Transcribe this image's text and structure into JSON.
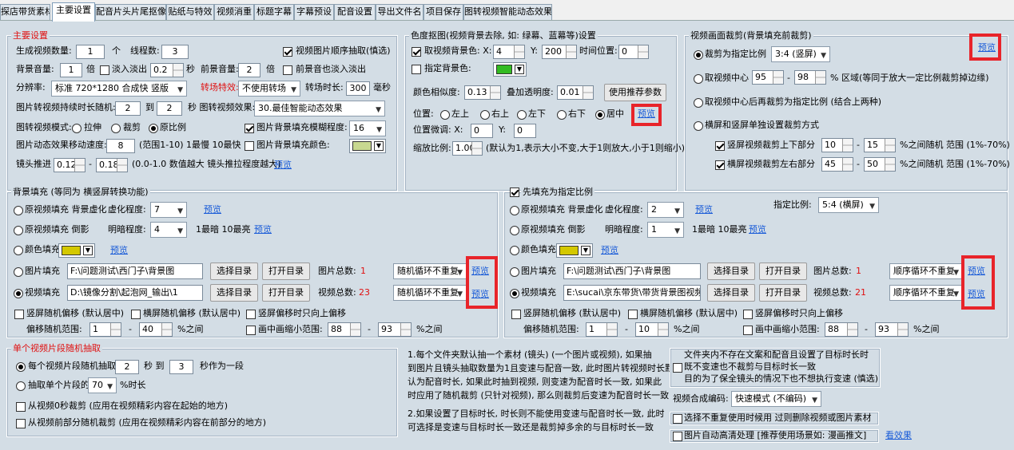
{
  "tabs": [
    "探店带货素材",
    "主要设置",
    "配音片头片尾抠像",
    "贴纸与特效",
    "视频消重",
    "标题字幕",
    "字幕预设",
    "配音设置",
    "导出文件名",
    "项目保存",
    "图转视频智能动态效果"
  ],
  "common": {
    "preview": "预览",
    "choose_dir": "选择目录",
    "open_dir": "打开目录",
    "to": "到",
    "dash": "-",
    "view_effect": "看效果"
  },
  "main": {
    "title": "主要设置",
    "gen_count_label": "生成视频数量:",
    "gen_count": "1",
    "gen_unit": "个",
    "threads_label": "线程数:",
    "threads": "3",
    "seq_extract": "视频图片顺序抽取(慎选)",
    "bg_vol_label": "背景音量:",
    "bg_vol": "1",
    "times": "倍",
    "fade_label": "淡入淡出",
    "fade_val": "0.2",
    "sec": "秒",
    "fg_vol_label": "前景音量:",
    "fg_vol": "2",
    "fg_fade": "前景音也淡入淡出",
    "res_label": "分辨率:",
    "res_val": "标准 720*1280 合成快 竖版",
    "trans_label": "转场特效:",
    "trans_val": "不使用转场",
    "trans_dur_label": "转场时长:",
    "trans_dur": "300",
    "ms": "毫秒",
    "img_dur_label": "图片转视频持续时长随机:",
    "img_dur_a": "2",
    "img_dur_b": "2",
    "img_effect_label": "秒 图转视频效果:",
    "img_effect_val": "30.最佳智能动态效果",
    "img_mode_label": "图转视频模式:",
    "mode_stretch": "拉伸",
    "mode_crop": "裁剪",
    "mode_ratio": "原比例",
    "blur_label": "图片背景填充模糊程度:",
    "blur_val": "16",
    "speed_label": "图片动态效果移动速度:",
    "speed_val": "8",
    "speed_hint": "(范围1-10) 1最慢 10最快",
    "bg_color_label": "图片背景填充颜色:",
    "push_label": "镜头推进",
    "push_a": "0.12",
    "push_b": "0.18",
    "push_hint": "(0.0-1.0 数值越大 镜头推拉程度越大)"
  },
  "chroma": {
    "title": "色度抠图(视频背景去除, 如: 绿幕、蓝幕等)设置",
    "take_color": "取视频背景色: X:",
    "x_val": "4",
    "y_label": "Y:",
    "y_val": "200",
    "time_pos_label": "时间位置:",
    "time_pos": "0",
    "spec_bg": "指定背景色:",
    "similarity_label": "颜色相似度:",
    "similarity": "0.13",
    "overlay_label": "叠加透明度:",
    "overlay": "0.01",
    "recommend": "使用推荐参数",
    "pos_label": "位置:",
    "pos_tl": "左上",
    "pos_tr": "右上",
    "pos_bl": "左下",
    "pos_br": "右下",
    "pos_c": "居中",
    "fine_label": "位置微调:  X:",
    "fine_x": "0",
    "fine_y_label": "Y:",
    "fine_y": "0",
    "scale_label": "缩放比例:",
    "scale": "1.00",
    "scale_hint": "(默认为1,表示大小不变,大于1则放大,小于1则缩小)"
  },
  "crop": {
    "title": "视频画面裁剪(背景填充前裁剪)",
    "opt1": "裁剪为指定比例",
    "opt1_val": "3:4 (竖屏)",
    "opt2": "取视频中心",
    "opt2_a": "95",
    "opt2_b": "98",
    "opt2_hint": "% 区域(等同于放大一定比例裁剪掉边缘)",
    "opt3": "取视频中心后再裁剪为指定比例 (结合上两种)",
    "opt4": "横屏和竖屏单独设置裁剪方式",
    "v_label": "竖屏视频裁剪上下部分",
    "v_a": "10",
    "v_b": "15",
    "v_hint": "%之间随机 范围 (1%-70%)",
    "h_label": "横屏视频裁剪左右部分",
    "h_a": "45",
    "h_b": "50",
    "h_hint": "%之间随机 范围 (1%-70%)"
  },
  "bgfill": {
    "title": "背景填充 (等同为 横竖屏转换功能)",
    "orig_blur": "原视频填充 背景虚化",
    "blur_deg_label": "虚化程度:",
    "blur_deg": "7",
    "orig_inv": "原视频填充 倒影",
    "bright_label": "明暗程度:",
    "bright": "4",
    "bright_hint": "1最暗 10最亮",
    "color_fill": "颜色填充",
    "img_fill": "图片填充",
    "img_path": "F:\\问题测试\\西门子\\背景图",
    "img_total_label": "图片总数:",
    "img_total": "1",
    "img_mode": "随机循环不重复",
    "vid_fill": "视频填充",
    "vid_path": "D:\\镜像分割\\起泡网_输出\\1",
    "vid_total_label": "视频总数:",
    "vid_total": "23",
    "vid_mode": "随机循环不重复",
    "v_offset": "竖屏随机偏移 (默认居中)",
    "h_offset": "横屏随机偏移 (默认居中)",
    "v_up": "竖屏偏移时只向上偏移",
    "offset_range_label": "偏移随机范围:",
    "off_a": "1",
    "off_b": "40",
    "pct_between": "%之间",
    "shrink_label": "画中画缩小范围:",
    "shrink_a": "88",
    "shrink_b": "93"
  },
  "fill2": {
    "title": "先填充为指定比例",
    "ratio_label": "指定比例:",
    "ratio_val": "5:4 (横屏)",
    "blur_deg": "2",
    "bright": "1",
    "img_path": "F:\\问题测试\\西门子\\背景图",
    "img_total": "1",
    "img_mode": "顺序循环不重复",
    "vid_path": "E:\\sucai\\京东带货\\带货背景图视频",
    "vid_total": "21",
    "vid_mode": "顺序循环不重复",
    "off_a": "1",
    "off_b": "10",
    "shrink_a": "88",
    "shrink_b": "93"
  },
  "clip": {
    "title": "单个视频片段随机抽取",
    "opt1": "每个视频片段随机抽取",
    "opt1_a": "2",
    "sec_to": "秒 到",
    "opt1_b": "3",
    "opt1_hint": "秒作为一段",
    "opt2": "抽取单个片段的",
    "opt2_val": "70",
    "opt2_hint": "%时长",
    "opt3": "从视频0秒裁剪 (应用在视频精彩内容在起始的地方)",
    "opt4": "从视频前部分随机裁剪 (应用在视频精彩内容在前部分的地方)"
  },
  "notes": {
    "lines1": [
      "1.每个文件夹默认抽一个素材 (镜头) (一个图片或视频), 如果抽",
      "到图片且镜头抽取数量为1且变速与配音一致, 此时图片转视频时长默",
      "认为配音时长, 如果此时抽到视频, 则变速为配音时长一致, 如果此",
      "时应用了随机裁剪 (只针对视频), 那么则裁剪后变速为配音时长一致"
    ],
    "lines2": [
      "2.如果设置了目标时长, 时长则不能使用变速与配音时长一致, 此时",
      "可选择是变速与目标时长一致还是裁剪掉多余的与目标时长一致"
    ]
  },
  "right_bottom": {
    "line1": "文件夹内不存在文案和配音且设置了目标时长时",
    "line2": "既不变速也不裁剪与目标时长一致",
    "line3": "目的为了保全镜头的情况下也不想执行变速 (慎选)",
    "codec_label": "视频合成编码:",
    "codec_val": "快速模式 (不编码)",
    "no_repeat": "选择不重复使用时候用 过则删除视频或图片素材",
    "hd": "图片自动高清处理 [推荐使用场景如: 漫画推文]"
  },
  "colors": {
    "accent_red": "#e8242a",
    "link_blue": "#1a5cd8",
    "panel_bg": "#d3dde5",
    "swatch_green": "#33bb22",
    "swatch_yellow": "#d4c800",
    "swatch_khaki": "#c8d890"
  }
}
